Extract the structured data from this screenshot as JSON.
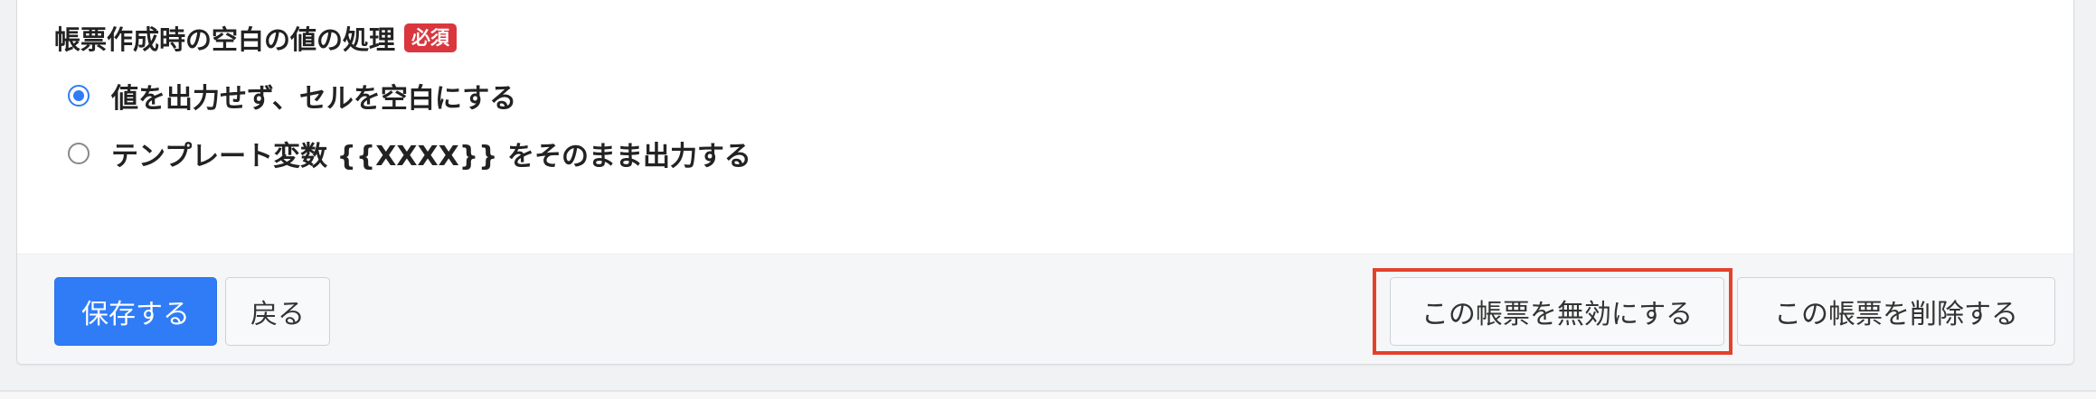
{
  "section": {
    "title": "帳票作成時の空白の値の処理",
    "required_badge": "必須"
  },
  "options": [
    {
      "label": "値を出力せず、セルを空白にする",
      "checked": true
    },
    {
      "label": "テンプレート変数 {{XXXX}} をそのまま出力する",
      "checked": false
    }
  ],
  "footer": {
    "save_label": "保存する",
    "back_label": "戻る",
    "disable_label": "この帳票を無効にする",
    "delete_label": "この帳票を削除する"
  },
  "colors": {
    "accent": "#2f7cf6",
    "required_badge": "#d9363e",
    "highlight": "#e4412c"
  }
}
